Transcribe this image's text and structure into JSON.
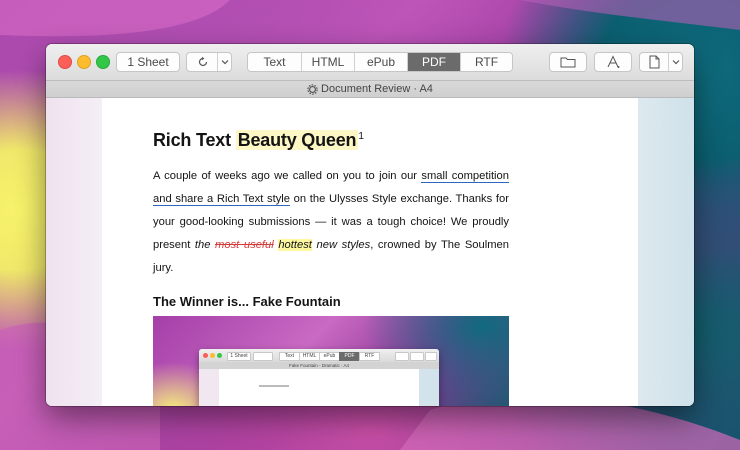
{
  "toolbar": {
    "sheet_button": "1 Sheet",
    "refresh_icon": "refresh-icon",
    "dropdown_icon": "chevron-down-icon",
    "formats": [
      {
        "label": "Text",
        "active": false
      },
      {
        "label": "HTML",
        "active": false
      },
      {
        "label": "ePub",
        "active": false
      },
      {
        "label": "PDF",
        "active": true
      },
      {
        "label": "RTF",
        "active": false
      }
    ],
    "folder_icon": "folder-icon",
    "style_icon": "font-style-icon",
    "document_icon": "document-icon"
  },
  "window": {
    "title": "Document Review · A4",
    "title_icon": "gear-icon"
  },
  "document": {
    "heading_plain": "Rich Text ",
    "heading_highlight": "Beauty Queen",
    "heading_footnote": "1",
    "para_1": "A couple of weeks ago we called on you to join our ",
    "link_text": "small competition and share a Rich Text style",
    "para_2": " on the Ulysses Style exchange. Thanks for your good-looking submissions — it was a tough choice! We proudly present ",
    "para_3_italic_1": "the ",
    "strike_text": "most useful",
    "hottest_text": "hottest",
    "para_3_italic_2": " new styles",
    "para_3_end": ", crowned by The Soulmen jury.",
    "subheading": "The Winner is... Fake Fountain"
  },
  "embedded_screenshot": {
    "sheet_button": "1 Sheet",
    "formats": [
      "Text",
      "HTML",
      "ePub",
      "PDF",
      "RTF"
    ],
    "active_format": "PDF",
    "title": "Fake Fountain - Dramatic · A4"
  },
  "colors": {
    "active_segment": "#6b6b6b",
    "link_underline": "#2f66c2",
    "highlight": "#fdf7c6",
    "strike": "#d43c3c",
    "traffic_close": "#fc5f57",
    "traffic_min": "#fdbc2e",
    "traffic_max": "#33c748"
  }
}
